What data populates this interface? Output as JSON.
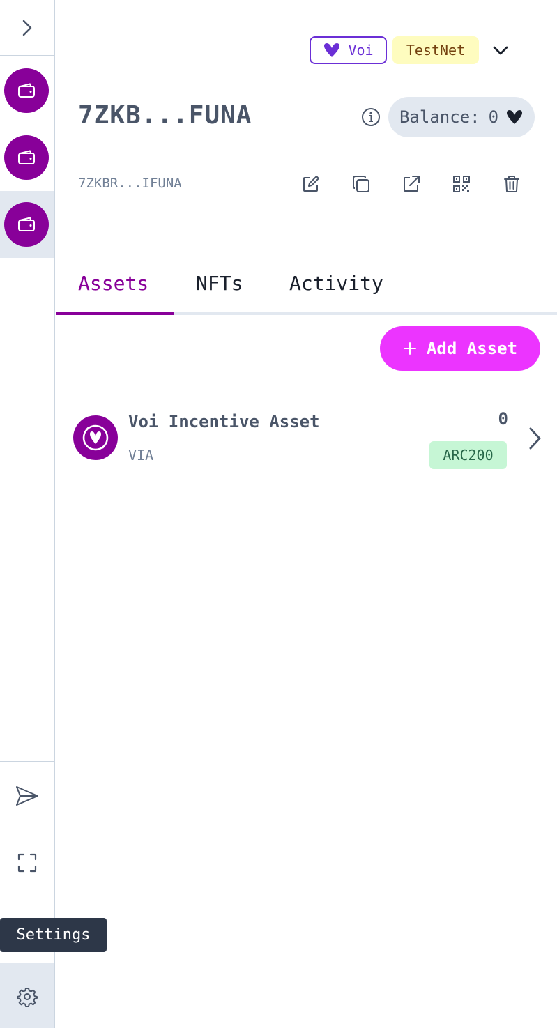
{
  "sidebar": {
    "wallets": [
      {
        "icon": "wallet-icon",
        "active": false
      },
      {
        "icon": "wallet-icon",
        "active": false
      },
      {
        "icon": "wallet-icon",
        "active": true
      }
    ],
    "bottom_buttons": [
      {
        "icon": "send-icon"
      },
      {
        "icon": "scan-icon"
      },
      {
        "icon": "gear-icon"
      }
    ],
    "tooltip": "Settings"
  },
  "header": {
    "network_name": "Voi",
    "network_badge": "TestNet",
    "account_title": "7ZKB...FUNA",
    "balance_label": "Balance:",
    "balance_value": "0",
    "address_short": "7ZKBR...IFUNA"
  },
  "tabs": [
    {
      "label": "Assets",
      "active": true
    },
    {
      "label": "NFTs",
      "active": false
    },
    {
      "label": "Activity",
      "active": false
    }
  ],
  "add_asset_label": "Add Asset",
  "assets": [
    {
      "name": "Voi Incentive Asset",
      "symbol": "VIA",
      "amount": "0",
      "standard": "ARC200"
    }
  ],
  "colors": {
    "primary": "#880099",
    "add_button": "#ec34ff",
    "network_accent": "#6b2fd6",
    "testnet_bg": "#fefcbf",
    "badge_bg": "#c6f6d5"
  }
}
